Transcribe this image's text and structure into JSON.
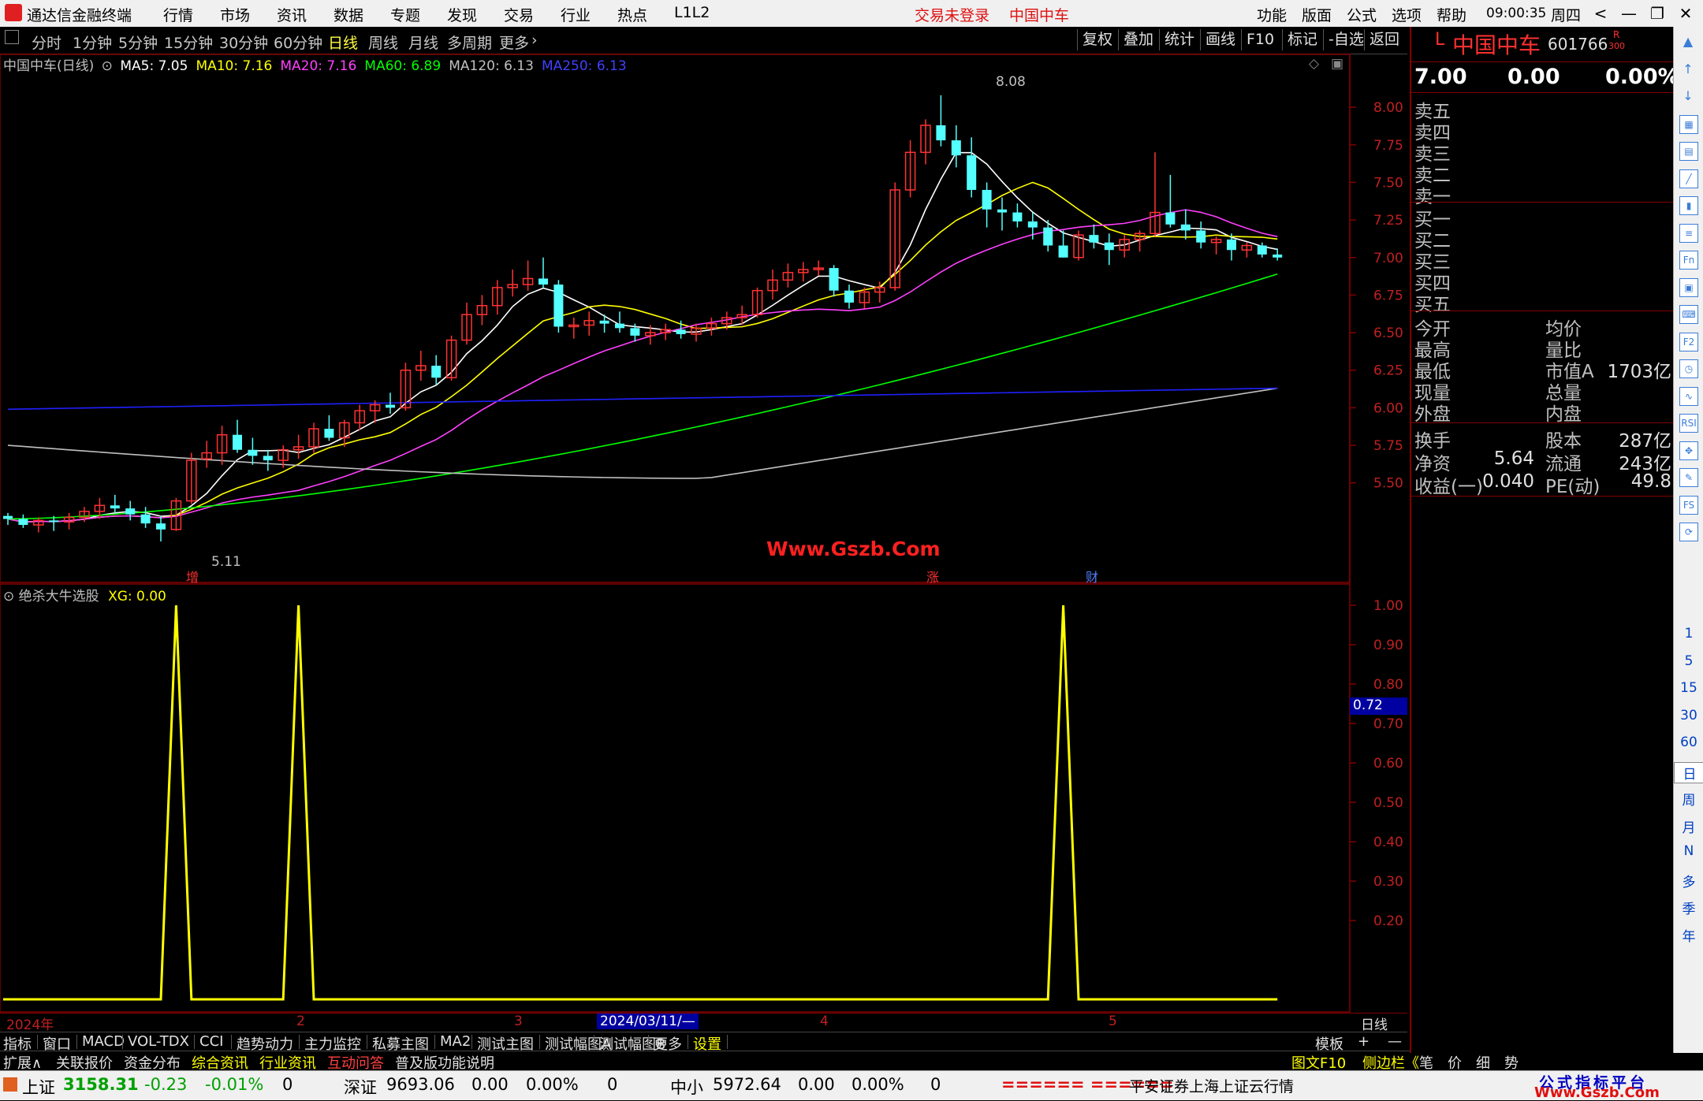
{
  "titlebar": {
    "app_name": "通达信金融终端",
    "menu": [
      "行情",
      "市场",
      "资讯",
      "数据",
      "专题",
      "发现",
      "交易",
      "行业",
      "热点",
      "L1L2"
    ],
    "login_status": "交易未登录",
    "stock_title": "中国中车",
    "right_menu": [
      "功能",
      "版面",
      "公式",
      "选项",
      "帮助"
    ],
    "time": "09:00:35",
    "weekday": "周四",
    "win_buttons": [
      "<",
      "—",
      "❐",
      "✕"
    ]
  },
  "periodbar": {
    "periods": [
      "分时",
      "1分钟",
      "5分钟",
      "15分钟",
      "30分钟",
      "60分钟",
      "日线",
      "周线",
      "月线",
      "多周期",
      "更多"
    ],
    "selected": "日线",
    "right_buttons": [
      "复权",
      "叠加",
      "统计",
      "画线",
      "F10",
      "标记",
      "-自选",
      "返回"
    ]
  },
  "main_legend": {
    "name": "中国中车(日线)",
    "items": [
      {
        "label": "MA5: 7.05",
        "color": "#ffffff"
      },
      {
        "label": "MA10: 7.16",
        "color": "#ffff00"
      },
      {
        "label": "MA20: 7.16",
        "color": "#ff40ff"
      },
      {
        "label": "MA60: 6.89",
        "color": "#00ff00"
      },
      {
        "label": "MA120: 6.13",
        "color": "#c0c0c0"
      },
      {
        "label": "MA250: 6.13",
        "color": "#4040ff"
      }
    ]
  },
  "annotations": {
    "high_label": "8.08",
    "low_label": "5.11",
    "watermark": "Www.Gszb.Com",
    "markers": [
      "增",
      "涨",
      "财"
    ]
  },
  "sub_legend": {
    "name": "绝杀大牛选股",
    "value": "XG: 0.00"
  },
  "price_axis": [
    "8.00",
    "7.75",
    "7.50",
    "7.25",
    "7.00",
    "6.75",
    "6.50",
    "6.25",
    "6.00",
    "5.75",
    "5.50"
  ],
  "sub_axis": [
    "1.00",
    "0.90",
    "0.80",
    "0.70",
    "0.60",
    "0.50",
    "0.40",
    "0.30",
    "0.20"
  ],
  "sub_axis_highlight": "0.72",
  "date_axis": {
    "labels": [
      "2024年",
      "2",
      "3",
      "4",
      "5"
    ],
    "cursor_date": "2024/03/11/—",
    "period": "日线"
  },
  "tabs_row1": [
    "指标",
    "窗口",
    "MACD",
    "VOL-TDX",
    "CCI",
    "趋势动力",
    "主力监控",
    "私募主图",
    "MA2",
    "测试主图",
    "测试幅图A",
    "测试幅图B",
    "更多",
    "设置"
  ],
  "tabs_row1_right": [
    "模板",
    "+",
    "—"
  ],
  "tabs_row2": [
    {
      "label": "扩展∧",
      "color": "#e0e0e0"
    },
    {
      "label": "关联报价",
      "color": "#e0e0e0"
    },
    {
      "label": "资金分布",
      "color": "#e0e0e0"
    },
    {
      "label": "综合资讯",
      "color": "#ffff00"
    },
    {
      "label": "行业资讯",
      "color": "#ffff00"
    },
    {
      "label": "互动问答",
      "color": "#ff4040"
    },
    {
      "label": "普及版功能说明",
      "color": "#e0e0e0"
    }
  ],
  "tabs_row2_right": [
    "图文F10",
    "侧边栏《",
    "笔",
    "价",
    "细",
    "势"
  ],
  "quote_panel": {
    "market_flag": "L",
    "name": "中国中车",
    "code": "601766",
    "badge_r": "R",
    "badge_300": "300",
    "price": "7.00",
    "change": "0.00",
    "pct": "0.00%",
    "sell_levels": [
      "卖五",
      "卖四",
      "卖三",
      "卖二",
      "卖一"
    ],
    "buy_levels": [
      "买一",
      "买二",
      "买三",
      "买四",
      "买五"
    ],
    "stats_left": [
      "今开",
      "最高",
      "最低",
      "现量",
      "外盘"
    ],
    "stats_right": [
      "均价",
      "量比",
      "市值A",
      "总量",
      "内盘"
    ],
    "market_cap": "1703亿",
    "info": [
      {
        "l1": "换手",
        "v1": "",
        "l2": "股本",
        "v2": "287亿"
      },
      {
        "l1": "净资",
        "v1": "5.64",
        "l2": "流通",
        "v2": "243亿"
      },
      {
        "l1": "收益(一)",
        "v1": "0.040",
        "l2": "PE(动)",
        "v2": "49.8"
      }
    ]
  },
  "right_toolbar": {
    "icons": [
      "up-triangle-icon",
      "up-arrow-icon",
      "down-arrow-icon",
      "chart-icon",
      "table-icon",
      "line-icon",
      "k-line-icon",
      "list-icon",
      "f10-icon",
      "news-icon",
      "note-icon",
      "f2-icon",
      "clock-icon",
      "wave-icon",
      "rsi-icon",
      "move-icon",
      "pen-icon",
      "fs-icon",
      "refresh-icon"
    ],
    "icon_labels": [
      "▲",
      "↑",
      "↓",
      "▦",
      "▤",
      "╱",
      "▮",
      "≡",
      "Fn",
      "▣",
      "⌨",
      "F2",
      "◷",
      "∿",
      "RSI",
      "✥",
      "✎",
      "FS",
      "⟳"
    ],
    "periods": [
      "1",
      "5",
      "15",
      "30",
      "60",
      "日",
      "周",
      "月",
      "N",
      "多",
      "季",
      "年"
    ]
  },
  "statusbar": {
    "indices": [
      {
        "name": "上证",
        "value": "3158.31",
        "chg": "-0.23",
        "pct": "-0.01%",
        "vol": "0"
      },
      {
        "name": "深证",
        "value": "9693.06",
        "chg": "0.00",
        "pct": "0.00%",
        "vol": "0"
      },
      {
        "name": "中小",
        "value": "5972.64",
        "chg": "0.00",
        "pct": "0.00%",
        "vol": "0"
      }
    ],
    "ticker": "====== ======",
    "server": "平安证券上海上证云行情",
    "brand_top": "公式指标平台",
    "brand_bottom": "Www.Gszb.Com"
  },
  "chart_data": {
    "type": "candlestick",
    "ylim": [
      5.0,
      8.2
    ],
    "candles": [
      [
        5.28,
        5.3,
        5.22,
        5.26
      ],
      [
        5.26,
        5.29,
        5.2,
        5.22
      ],
      [
        5.22,
        5.27,
        5.17,
        5.25
      ],
      [
        5.25,
        5.28,
        5.18,
        5.24
      ],
      [
        5.24,
        5.3,
        5.19,
        5.27
      ],
      [
        5.27,
        5.34,
        5.24,
        5.31
      ],
      [
        5.31,
        5.4,
        5.26,
        5.35
      ],
      [
        5.35,
        5.42,
        5.3,
        5.33
      ],
      [
        5.33,
        5.38,
        5.25,
        5.29
      ],
      [
        5.29,
        5.34,
        5.2,
        5.23
      ],
      [
        5.23,
        5.28,
        5.11,
        5.19
      ],
      [
        5.19,
        5.4,
        5.18,
        5.38
      ],
      [
        5.38,
        5.7,
        5.36,
        5.65
      ],
      [
        5.66,
        5.78,
        5.6,
        5.7
      ],
      [
        5.7,
        5.88,
        5.62,
        5.82
      ],
      [
        5.82,
        5.92,
        5.7,
        5.72
      ],
      [
        5.72,
        5.8,
        5.62,
        5.68
      ],
      [
        5.68,
        5.72,
        5.58,
        5.65
      ],
      [
        5.65,
        5.75,
        5.6,
        5.72
      ],
      [
        5.72,
        5.82,
        5.66,
        5.74
      ],
      [
        5.74,
        5.9,
        5.7,
        5.86
      ],
      [
        5.86,
        5.95,
        5.78,
        5.8
      ],
      [
        5.8,
        5.92,
        5.74,
        5.9
      ],
      [
        5.9,
        6.02,
        5.85,
        5.98
      ],
      [
        5.98,
        6.05,
        5.9,
        6.02
      ],
      [
        6.02,
        6.1,
        5.96,
        6.0
      ],
      [
        6.0,
        6.3,
        5.98,
        6.25
      ],
      [
        6.25,
        6.38,
        6.18,
        6.28
      ],
      [
        6.28,
        6.35,
        6.15,
        6.2
      ],
      [
        6.2,
        6.48,
        6.18,
        6.45
      ],
      [
        6.45,
        6.7,
        6.42,
        6.62
      ],
      [
        6.62,
        6.75,
        6.55,
        6.68
      ],
      [
        6.68,
        6.85,
        6.62,
        6.8
      ],
      [
        6.8,
        6.92,
        6.74,
        6.82
      ],
      [
        6.82,
        6.98,
        6.78,
        6.86
      ],
      [
        6.86,
        7.0,
        6.8,
        6.82
      ],
      [
        6.82,
        6.85,
        6.5,
        6.54
      ],
      [
        6.54,
        6.6,
        6.46,
        6.55
      ],
      [
        6.55,
        6.64,
        6.48,
        6.58
      ],
      [
        6.58,
        6.62,
        6.5,
        6.56
      ],
      [
        6.56,
        6.64,
        6.5,
        6.53
      ],
      [
        6.53,
        6.56,
        6.44,
        6.48
      ],
      [
        6.48,
        6.55,
        6.42,
        6.5
      ],
      [
        6.5,
        6.56,
        6.45,
        6.52
      ],
      [
        6.52,
        6.58,
        6.46,
        6.49
      ],
      [
        6.49,
        6.56,
        6.44,
        6.53
      ],
      [
        6.53,
        6.6,
        6.48,
        6.56
      ],
      [
        6.56,
        6.64,
        6.52,
        6.6
      ],
      [
        6.6,
        6.68,
        6.55,
        6.62
      ],
      [
        6.62,
        6.8,
        6.6,
        6.78
      ],
      [
        6.78,
        6.92,
        6.72,
        6.85
      ],
      [
        6.85,
        6.96,
        6.8,
        6.9
      ],
      [
        6.9,
        6.97,
        6.84,
        6.92
      ],
      [
        6.92,
        6.98,
        6.88,
        6.93
      ],
      [
        6.93,
        6.95,
        6.74,
        6.78
      ],
      [
        6.78,
        6.82,
        6.66,
        6.7
      ],
      [
        6.7,
        6.8,
        6.66,
        6.77
      ],
      [
        6.77,
        6.84,
        6.7,
        6.8
      ],
      [
        6.8,
        7.5,
        6.78,
        7.45
      ],
      [
        7.45,
        7.78,
        7.4,
        7.7
      ],
      [
        7.7,
        7.92,
        7.62,
        7.88
      ],
      [
        7.88,
        8.08,
        7.74,
        7.78
      ],
      [
        7.78,
        7.88,
        7.6,
        7.68
      ],
      [
        7.68,
        7.8,
        7.4,
        7.45
      ],
      [
        7.45,
        7.5,
        7.2,
        7.32
      ],
      [
        7.32,
        7.4,
        7.18,
        7.3
      ],
      [
        7.3,
        7.36,
        7.2,
        7.24
      ],
      [
        7.24,
        7.3,
        7.12,
        7.2
      ],
      [
        7.2,
        7.25,
        7.04,
        7.08
      ],
      [
        7.08,
        7.18,
        7.0,
        7.0
      ],
      [
        7.0,
        7.18,
        6.98,
        7.15
      ],
      [
        7.15,
        7.22,
        7.06,
        7.1
      ],
      [
        7.1,
        7.16,
        6.95,
        7.05
      ],
      [
        7.05,
        7.15,
        7.0,
        7.12
      ],
      [
        7.12,
        7.18,
        7.04,
        7.16
      ],
      [
        7.16,
        7.7,
        7.14,
        7.3
      ],
      [
        7.3,
        7.55,
        7.2,
        7.22
      ],
      [
        7.22,
        7.32,
        7.12,
        7.18
      ],
      [
        7.18,
        7.24,
        7.06,
        7.1
      ],
      [
        7.1,
        7.14,
        7.02,
        7.12
      ],
      [
        7.12,
        7.16,
        6.98,
        7.05
      ],
      [
        7.05,
        7.1,
        7.0,
        7.08
      ],
      [
        7.08,
        7.1,
        7.0,
        7.02
      ],
      [
        7.02,
        7.06,
        6.98,
        7.0
      ]
    ],
    "signal_x": [
      11,
      19,
      69
    ]
  }
}
